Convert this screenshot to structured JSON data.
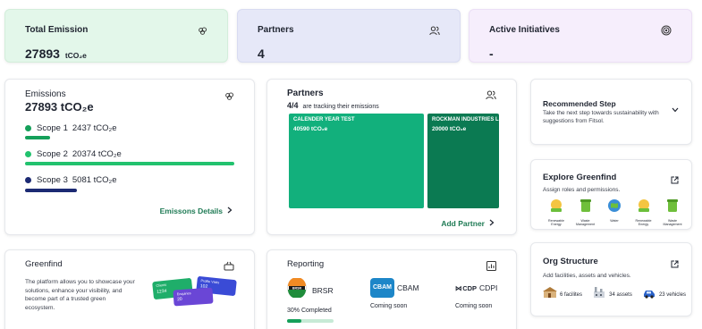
{
  "summary": {
    "total_emission": {
      "label": "Total Emission",
      "value": "27893",
      "unit": "tCO₂e"
    },
    "partners": {
      "label": "Partners",
      "value": "4"
    },
    "active_initiatives": {
      "label": "Active Initiatives",
      "value": "-"
    }
  },
  "emissions": {
    "title": "Emissions",
    "total": "27893 tCO₂e",
    "scopes": [
      {
        "label": "Scope 1",
        "value": "2437 tCO₂e",
        "color": "#15a05a",
        "share": 0.087
      },
      {
        "label": "Scope 2",
        "value": "20374 tCO₂e",
        "color": "#22c26e",
        "share": 1.0
      },
      {
        "label": "Scope 3",
        "value": "5081 tCO₂e",
        "color": "#1c2a73",
        "share": 0.24
      }
    ],
    "details_link": "Emissons Details"
  },
  "partners_card": {
    "title": "Partners",
    "count": "4/4",
    "count_suffix": "are tracking their emissions",
    "tiles": [
      {
        "name": "CALENDER YEAR TEST",
        "value": "40590 tCO₂e",
        "color": "#12b07c"
      },
      {
        "name": "ROCKMAN INDUSTRIES LIM",
        "value": "20000 tCO₂e",
        "color": "#0b7a52"
      }
    ],
    "add_link": "Add Partner"
  },
  "recommended": {
    "title": "Recommended Step",
    "text": "Take the next step towards sustainability with suggestions from Fitsol."
  },
  "explore": {
    "title": "Explore Greenfind",
    "text": "Assign roles and permissions.",
    "badges": [
      "Renewable Energy",
      "Waste Management",
      "Water",
      "Renewable Energy",
      "Waste Management"
    ]
  },
  "greenfind": {
    "title": "Greenfind",
    "text": "The platform allows you to showcase your solutions, enhance your visibility, and become part of a trusted green ecosystem.",
    "mini_cards": [
      {
        "label": "Clients",
        "value": "1234"
      },
      {
        "label": "Profile Visits",
        "value": "102"
      },
      {
        "label": "Enquiries",
        "value": "20"
      }
    ]
  },
  "reporting": {
    "title": "Reporting",
    "items": [
      {
        "logo": "BRSR",
        "name": "BRSR",
        "status": "30% Completed",
        "progress": 0.3
      },
      {
        "logo": "CBAM",
        "name": "CBAM",
        "status": "Coming soon"
      },
      {
        "logo": "CDP",
        "name": "CDPI",
        "status": "Coming soon"
      }
    ]
  },
  "org": {
    "title": "Org Structure",
    "text": "Add facilities, assets and vehicles.",
    "facilities": "6 facilites",
    "assets": "34 assets",
    "vehicles": "23 vehicles"
  }
}
